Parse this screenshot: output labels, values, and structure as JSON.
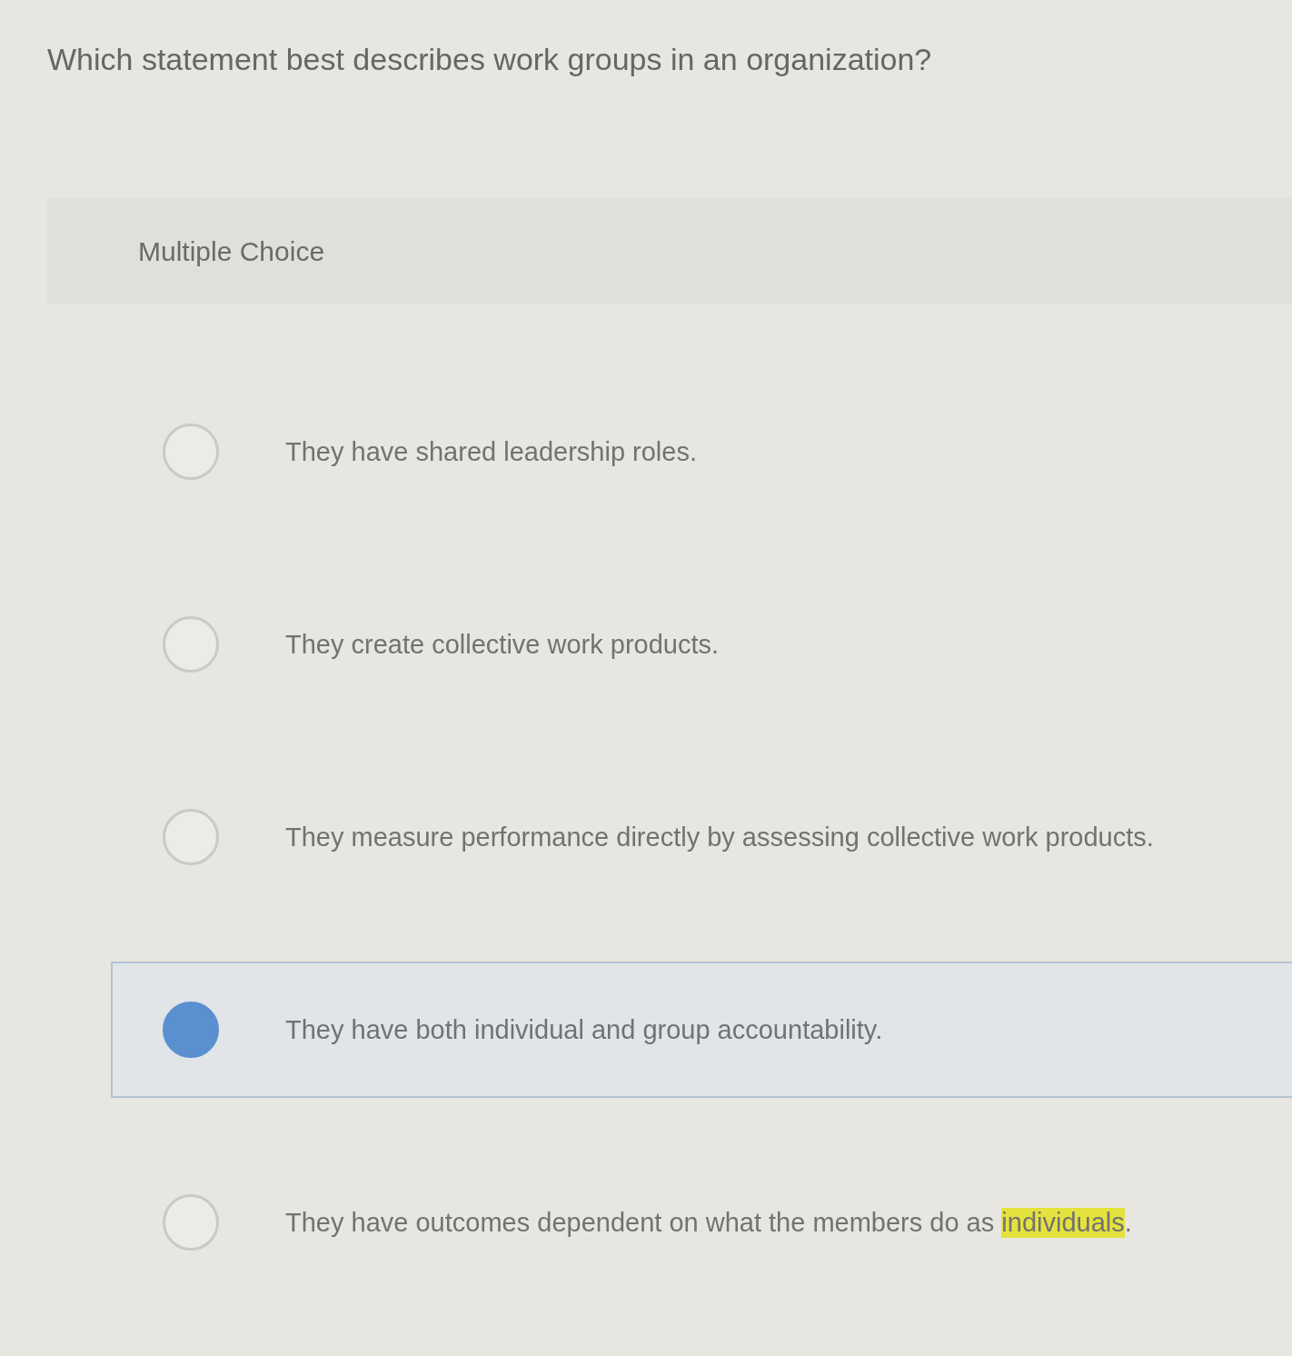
{
  "question": "Which statement best describes work groups in an organization?",
  "question_type": "Multiple Choice",
  "options": [
    {
      "selected": false,
      "parts": [
        {
          "text": "They have shared leadership roles.",
          "highlighted": false
        }
      ]
    },
    {
      "selected": false,
      "parts": [
        {
          "text": "They create collective work products.",
          "highlighted": false
        }
      ]
    },
    {
      "selected": false,
      "parts": [
        {
          "text": "They measure performance directly by assessing collective work products.",
          "highlighted": false
        }
      ]
    },
    {
      "selected": true,
      "parts": [
        {
          "text": "They have both individual and group accountability.",
          "highlighted": false
        }
      ]
    },
    {
      "selected": false,
      "parts": [
        {
          "text": "They have outcomes dependent on what the members do as ",
          "highlighted": false
        },
        {
          "text": "individuals",
          "highlighted": true
        },
        {
          "text": ".",
          "highlighted": false
        }
      ]
    }
  ]
}
